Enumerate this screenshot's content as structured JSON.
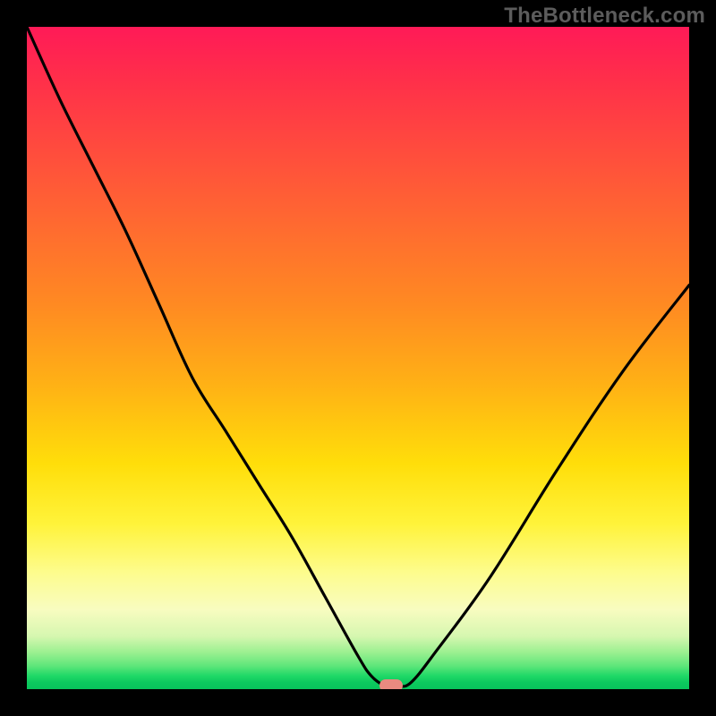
{
  "watermark": "TheBottleneck.com",
  "colors": {
    "background": "#000000",
    "curve_stroke": "#000000",
    "marker": "#e98a80"
  },
  "chart_data": {
    "type": "line",
    "title": "",
    "xlabel": "",
    "ylabel": "",
    "xlim": [
      0,
      100
    ],
    "ylim": [
      0,
      100
    ],
    "grid": false,
    "legend": false,
    "description": "V-shaped bottleneck curve over vertical red-to-green gradient; minimum (~0) near x≈55 marked by a small rounded rectangle.",
    "series": [
      {
        "name": "bottleneck-curve",
        "x": [
          0,
          5,
          10,
          15,
          20,
          25,
          30,
          35,
          40,
          45,
          50,
          52,
          54,
          55,
          56,
          58,
          62,
          70,
          80,
          90,
          100
        ],
        "values": [
          100,
          89,
          79,
          69,
          58,
          47,
          39,
          31,
          23,
          14,
          5,
          2,
          0.5,
          0.5,
          0.5,
          1,
          6,
          17,
          33,
          48,
          61
        ]
      }
    ],
    "marker": {
      "x": 55,
      "y": 0.5
    },
    "gradient_stops": [
      {
        "pct": 0,
        "color": "#ff1a57"
      },
      {
        "pct": 18,
        "color": "#ff4a3e"
      },
      {
        "pct": 42,
        "color": "#ff8a22"
      },
      {
        "pct": 66,
        "color": "#ffde0a"
      },
      {
        "pct": 82,
        "color": "#fdfc8e"
      },
      {
        "pct": 96,
        "color": "#5ee67a"
      },
      {
        "pct": 100,
        "color": "#08c35b"
      }
    ]
  }
}
